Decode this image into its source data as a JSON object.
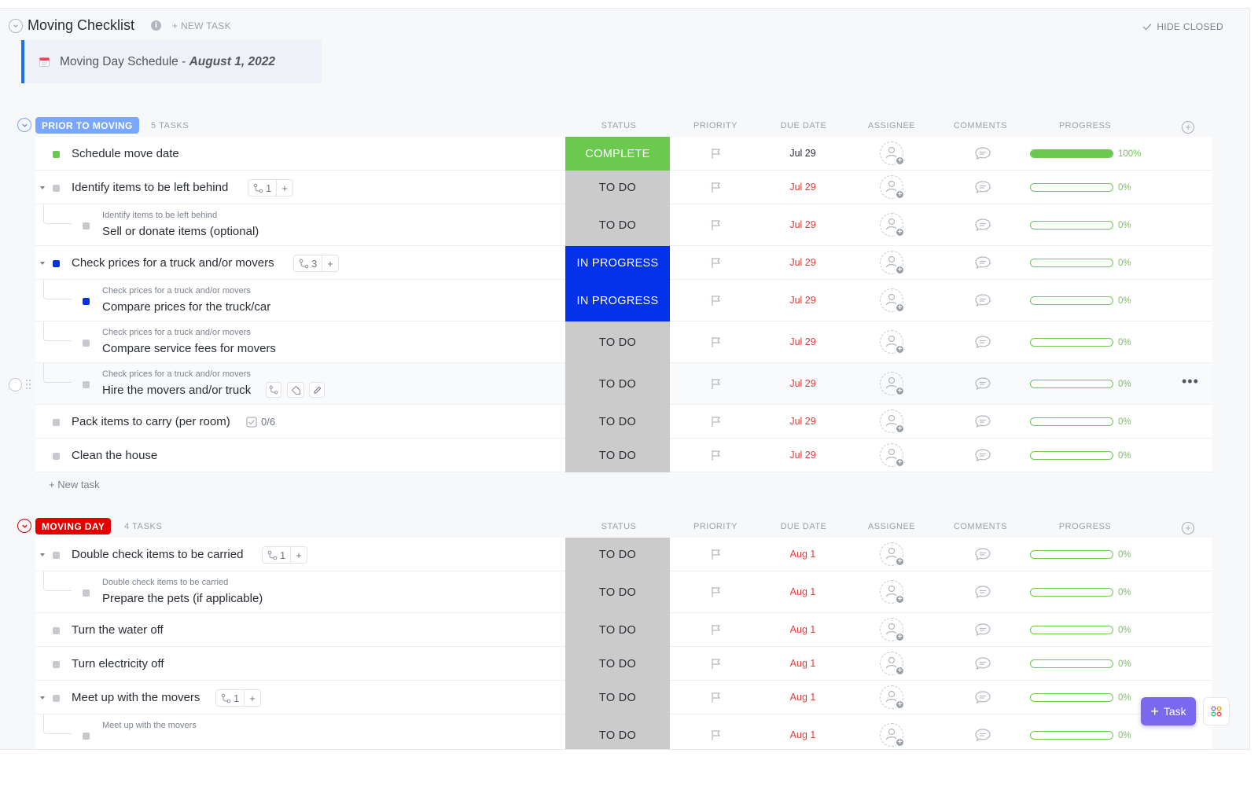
{
  "header": {
    "list_title": "Moving Checklist",
    "new_task_label": "+ NEW TASK",
    "hide_closed_label": "HIDE CLOSED"
  },
  "banner": {
    "text": "Moving Day Schedule - ",
    "date": "August 1, 2022"
  },
  "colors": {
    "accent_blue": "#1d6ff2",
    "section_prior": "#79a7ff",
    "section_moving": "#e50000",
    "status_todo": "#cbcbcb",
    "status_complete": "#6bc950",
    "status_in_progress": "#0231e8",
    "due_overdue": "#e13c3c",
    "fab": "#7b68ee"
  },
  "columns": {
    "status": "STATUS",
    "priority": "PRIORITY",
    "due_date": "DUE DATE",
    "assignee": "ASSIGNEE",
    "comments": "COMMENTS",
    "progress": "PROGRESS"
  },
  "sections": [
    {
      "name": "PRIOR TO MOVING",
      "count": "5 TASKS",
      "new_task_label": "+ New task",
      "rows": [
        {
          "name": "Schedule move date",
          "status": "COMPLETE",
          "due": "Jul 29",
          "progress": "100%",
          "progress_value": 1.0,
          "square_color": "#6bc950",
          "due_overdue": false
        },
        {
          "name": "Identify items to be left behind",
          "subtask_count": "1",
          "status": "TO DO",
          "due": "Jul 29",
          "progress": "0%",
          "progress_value": 0,
          "square_color": "#c7c9ce",
          "due_overdue": true
        },
        {
          "parent": "Identify items to be left behind",
          "name": "Sell or donate items (optional)",
          "status": "TO DO",
          "due": "Jul 29",
          "progress": "0%",
          "progress_value": 0,
          "square_color": "#c7c9ce",
          "due_overdue": true
        },
        {
          "name": "Check prices for a truck and/or movers",
          "subtask_count": "3",
          "status": "IN PROGRESS",
          "due": "Jul 29",
          "progress": "0%",
          "progress_value": 0,
          "square_color": "#0231e8",
          "due_overdue": true
        },
        {
          "parent": "Check prices for a truck and/or movers",
          "name": "Compare prices for the truck/car",
          "status": "IN PROGRESS",
          "due": "Jul 29",
          "progress": "0%",
          "progress_value": 0,
          "square_color": "#0231e8",
          "due_overdue": true
        },
        {
          "parent": "Check prices for a truck and/or movers",
          "name": "Compare service fees for movers",
          "status": "TO DO",
          "due": "Jul 29",
          "progress": "0%",
          "progress_value": 0,
          "square_color": "#c7c9ce",
          "due_overdue": true
        },
        {
          "parent": "Check prices for a truck and/or movers",
          "name": "Hire the movers and/or truck",
          "status": "TO DO",
          "due": "Jul 29",
          "progress": "0%",
          "progress_value": 0,
          "square_color": "#c7c9ce",
          "due_overdue": true
        },
        {
          "name": "Pack items to carry (per room)",
          "checklist": "0/6",
          "status": "TO DO",
          "due": "Jul 29",
          "progress": "0%",
          "progress_value": 0,
          "square_color": "#c7c9ce",
          "due_overdue": true
        },
        {
          "name": "Clean the house",
          "status": "TO DO",
          "due": "Jul 29",
          "progress": "0%",
          "progress_value": 0,
          "square_color": "#c7c9ce",
          "due_overdue": true
        }
      ]
    },
    {
      "name": "MOVING DAY",
      "count": "4 TASKS",
      "rows": [
        {
          "name": "Double check items to be carried",
          "subtask_count": "1",
          "status": "TO DO",
          "due": "Aug 1",
          "progress": "0%",
          "progress_value": 0,
          "square_color": "#c7c9ce",
          "due_overdue": true
        },
        {
          "parent": "Double check items to be carried",
          "name": "Prepare the pets (if applicable)",
          "status": "TO DO",
          "due": "Aug 1",
          "progress": "0%",
          "progress_value": 0,
          "square_color": "#c7c9ce",
          "due_overdue": true
        },
        {
          "name": "Turn the water off",
          "status": "TO DO",
          "due": "Aug 1",
          "progress": "0%",
          "progress_value": 0,
          "square_color": "#c7c9ce",
          "due_overdue": true
        },
        {
          "name": "Turn electricity off",
          "status": "TO DO",
          "due": "Aug 1",
          "progress": "0%",
          "progress_value": 0,
          "square_color": "#c7c9ce",
          "due_overdue": true
        },
        {
          "name": "Meet up with the movers",
          "subtask_count": "1",
          "status": "TO DO",
          "due": "Aug 1",
          "progress": "0%",
          "progress_value": 0,
          "square_color": "#c7c9ce",
          "due_overdue": true
        },
        {
          "parent": "Meet up with the movers",
          "name": "",
          "status": "TO DO",
          "due": "Aug 1",
          "progress": "0%",
          "progress_value": 0,
          "square_color": "#c7c9ce",
          "due_overdue": true
        }
      ]
    }
  ],
  "fab": {
    "label": "Task"
  }
}
